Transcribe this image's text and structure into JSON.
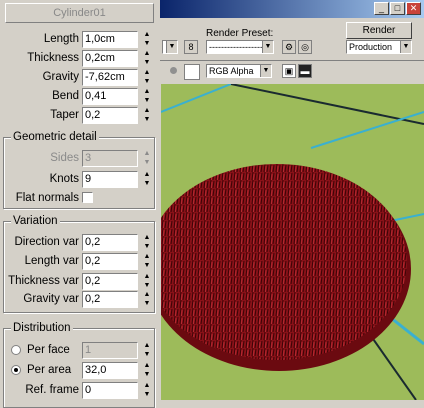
{
  "object_name": "Cylinder01",
  "params": [
    {
      "label": "Length",
      "value": "1,0cm"
    },
    {
      "label": "Thickness",
      "value": "0,2cm"
    },
    {
      "label": "Gravity",
      "value": "-7,62cm"
    },
    {
      "label": "Bend",
      "value": "0,41"
    },
    {
      "label": "Taper",
      "value": "0,2"
    }
  ],
  "geometric_detail": {
    "title": "Geometric detail",
    "sides": {
      "label": "Sides",
      "value": "3"
    },
    "knots": {
      "label": "Knots",
      "value": "9"
    },
    "flat_normals": {
      "label": "Flat normals",
      "checked": false
    }
  },
  "variation": {
    "title": "Variation",
    "rows": [
      {
        "label": "Direction var",
        "value": "0,2"
      },
      {
        "label": "Length var",
        "value": "0,2"
      },
      {
        "label": "Thickness var",
        "value": "0,2"
      },
      {
        "label": "Gravity var",
        "value": "0,2"
      }
    ]
  },
  "distribution": {
    "title": "Distribution",
    "per_face": {
      "label": "Per face",
      "value": "1",
      "selected": false
    },
    "per_area": {
      "label": "Per area",
      "value": "32,0",
      "selected": true
    },
    "ref_frame": {
      "label": "Ref. frame",
      "value": "0"
    }
  },
  "render_window": {
    "render_preset_label": "Render Preset:",
    "render_preset_value": "---------------------",
    "render_button": "Render",
    "mode_value": "Production",
    "channel_value": "RGB Alpha"
  },
  "colors": {
    "ground": "#9dbb5a",
    "fur": "#8a1118",
    "grid_line": "#3ab0d0",
    "titlebar": "#0a246a"
  }
}
